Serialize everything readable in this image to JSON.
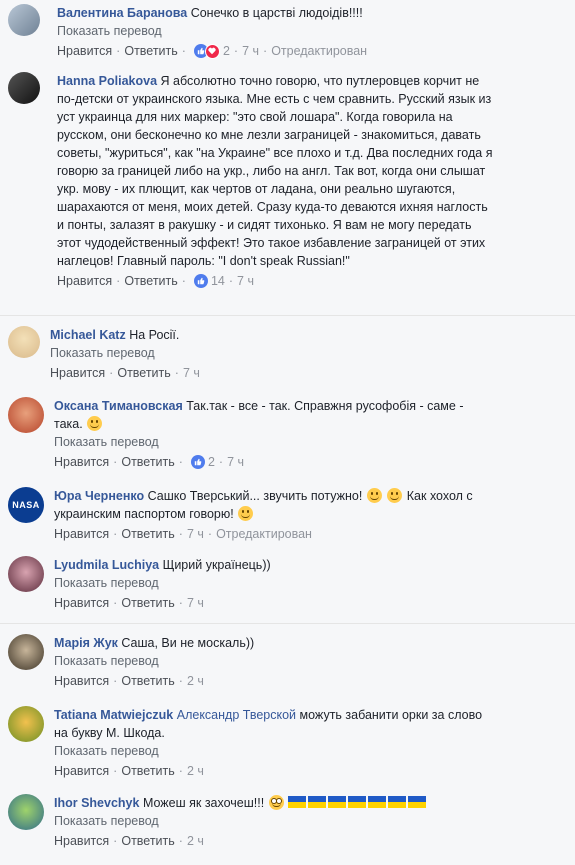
{
  "labels": {
    "like": "Нравится",
    "reply": "Ответить",
    "translate": "Показать перевод",
    "edited": "Отредактирован"
  },
  "comments": [
    {
      "author": "Валентина Баранова",
      "text": "Сонечко в царстві людоідів!!!!",
      "reactions": "2",
      "time": "7 ч"
    },
    {
      "author": "Hanna Poliakova",
      "lines": [
        "Я абсолютно точно говорю, что путлеровцев корчит не",
        "по-детски от украинского языка. Мне есть с чем сравнить. Русский язык из",
        "уст украинца для них маркер: \"это свой лошара\". Когда говорила на",
        "русском, они бесконечно ко мне лезли заграницей - знакомиться, давать",
        "советы, \"журиться\", как \"на Украине\" все плохо и т.д. Два последних года я",
        "говорю за границей либо на укр., либо на англ. Так вот, когда они слышат",
        "укр. мову - их плющит, как чертов от ладана, они реально шугаются,",
        "шарахаются от меня, моих детей. Сразу куда-то деваются ихняя наглость",
        "и понты, залазят в ракушку - и сидят тихонько. Я вам не могу передать",
        "этот чудодейственный эффект! Это такое избавление заграницей от этих",
        "наглецов! Главный пароль: \"I don't speak Russian!\""
      ],
      "reactions": "14",
      "time": "7 ч"
    },
    {
      "author": "Michael Katz",
      "text": "На Росії.",
      "time": "7 ч"
    },
    {
      "author": "Оксана Тимановская",
      "text1": "Так.так - все - так. Справжня русофобія - саме -",
      "text2": "така.",
      "reactions": "2",
      "time": "7 ч"
    },
    {
      "author": "Юра Черненко",
      "text1": "Сашко Тверський... звучить потужно!",
      "text2": "Как хохол с",
      "text3": "украинским паспортом говорю!",
      "time": "7 ч",
      "avatar_text": "NASA"
    },
    {
      "author": "Lyudmila Luchiya",
      "text": "Щирий українець))",
      "time": "7 ч"
    },
    {
      "author": "Марія Жук",
      "text": "Саша, Ви не москаль))",
      "time": "2 ч"
    },
    {
      "author": "Tatiana Matwiejczuk",
      "mention": "Александр Тверской",
      "text1": "можуть забанити орки за слово",
      "text2": "на букву М. Шкода.",
      "time": "2 ч"
    },
    {
      "author": "Ihor Shevchyk",
      "text": "Можеш як захочеш!!!",
      "time": "2 ч"
    }
  ],
  "colors": {
    "link": "#365899",
    "meta": "#606770",
    "like": "#4f7ced",
    "love": "#f0284a"
  }
}
